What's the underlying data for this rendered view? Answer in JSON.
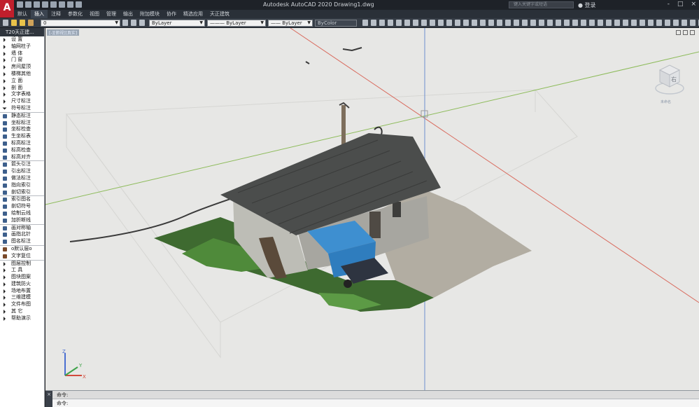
{
  "app": {
    "logo_letter": "A",
    "title": "Autodesk AutoCAD 2020    Drawing1.dwg",
    "search_placeholder": "键入关键字或短语",
    "login_label": "登录",
    "window_controls": [
      "-",
      "□",
      "×"
    ],
    "window_control_icons": [
      "minimize-icon",
      "restore-icon",
      "close-icon"
    ]
  },
  "ribbon": {
    "tabs": [
      {
        "label": "默认",
        "active": false
      },
      {
        "label": "插入",
        "active": true
      },
      {
        "label": "注释",
        "active": false
      },
      {
        "label": "参数化",
        "active": false
      },
      {
        "label": "视图",
        "active": false
      },
      {
        "label": "管理",
        "active": false
      },
      {
        "label": "输出",
        "active": false
      },
      {
        "label": "附加模块",
        "active": false
      },
      {
        "label": "协作",
        "active": false
      },
      {
        "label": "精选应用",
        "active": false
      },
      {
        "label": "天正建筑",
        "active": false
      }
    ]
  },
  "properties_toolbar": {
    "layer_value": "0",
    "color_value": "ByLayer",
    "linetype_value": "ByLayer",
    "lineweight_value": "ByLayer",
    "plotstyle_value": "ByColor"
  },
  "palette": {
    "header": "T20天正建...",
    "items": [
      {
        "label": "设    置",
        "icon": "arrow"
      },
      {
        "label": "轴网柱子",
        "icon": "arrow"
      },
      {
        "label": "墙    体",
        "icon": "arrow"
      },
      {
        "label": "门    窗",
        "icon": "arrow"
      },
      {
        "label": "房间屋顶",
        "icon": "arrow"
      },
      {
        "label": "楼梯其他",
        "icon": "arrow"
      },
      {
        "label": "立    面",
        "icon": "arrow"
      },
      {
        "label": "剖    面",
        "icon": "arrow"
      },
      {
        "label": "文字表格",
        "icon": "arrow"
      },
      {
        "label": "尺寸标注",
        "icon": "arrow"
      },
      {
        "label": "符号标注",
        "icon": "arrow-down"
      },
      {
        "label": "静态标注",
        "icon": "sym"
      },
      {
        "label": "坐标标注",
        "icon": "sym"
      },
      {
        "label": "坐标检查",
        "icon": "sym"
      },
      {
        "label": "生坐标表",
        "icon": "sym"
      },
      {
        "label": "标高标注",
        "icon": "sym"
      },
      {
        "label": "标高检查",
        "icon": "sym"
      },
      {
        "label": "标高对齐",
        "icon": "sym"
      },
      {
        "label": "箭头引注",
        "icon": "sym"
      },
      {
        "label": "引出标注",
        "icon": "sym"
      },
      {
        "label": "做法标注",
        "icon": "sym"
      },
      {
        "label": "指向索引",
        "icon": "sym"
      },
      {
        "label": "剖切索引",
        "icon": "sym"
      },
      {
        "label": "索引图名",
        "icon": "sym"
      },
      {
        "label": "剖切符号",
        "icon": "sym"
      },
      {
        "label": "绘制云线",
        "icon": "sym"
      },
      {
        "label": "加折断线",
        "icon": "sym"
      },
      {
        "label": "画对称轴",
        "icon": "sym"
      },
      {
        "label": "画指北针",
        "icon": "sym"
      },
      {
        "label": "图名标注",
        "icon": "sym"
      },
      {
        "label": "o默认层o",
        "icon": "sym2"
      },
      {
        "label": "文字复位",
        "icon": "sym2"
      },
      {
        "label": "图层控制",
        "icon": "arrow"
      },
      {
        "label": "工    具",
        "icon": "arrow"
      },
      {
        "label": "图块图案",
        "icon": "arrow"
      },
      {
        "label": "建筑防火",
        "icon": "arrow"
      },
      {
        "label": "场地布置",
        "icon": "arrow"
      },
      {
        "label": "三维建模",
        "icon": "arrow"
      },
      {
        "label": "文件布图",
        "icon": "arrow"
      },
      {
        "label": "其    它",
        "icon": "arrow"
      },
      {
        "label": "帮助演示",
        "icon": "arrow"
      }
    ]
  },
  "viewport": {
    "label": "[-][俯视][真实]",
    "viewcube_face": "右",
    "viewcube_sub": "未命名",
    "ucs_x": "X",
    "ucs_y": "Y",
    "ucs_z": "Z"
  },
  "command": {
    "history": [
      "命令:",
      "命令:"
    ],
    "close_glyph": "×"
  },
  "colors": {
    "title_bg": "#1e2228",
    "logo_red": "#c01f2c",
    "viewport_bg": "#e7e7e5",
    "axis_red": "#d96b5e",
    "axis_green": "#8dbb5a",
    "roof": "#4a4c4b",
    "awning_blue": "#3e8fd0"
  }
}
